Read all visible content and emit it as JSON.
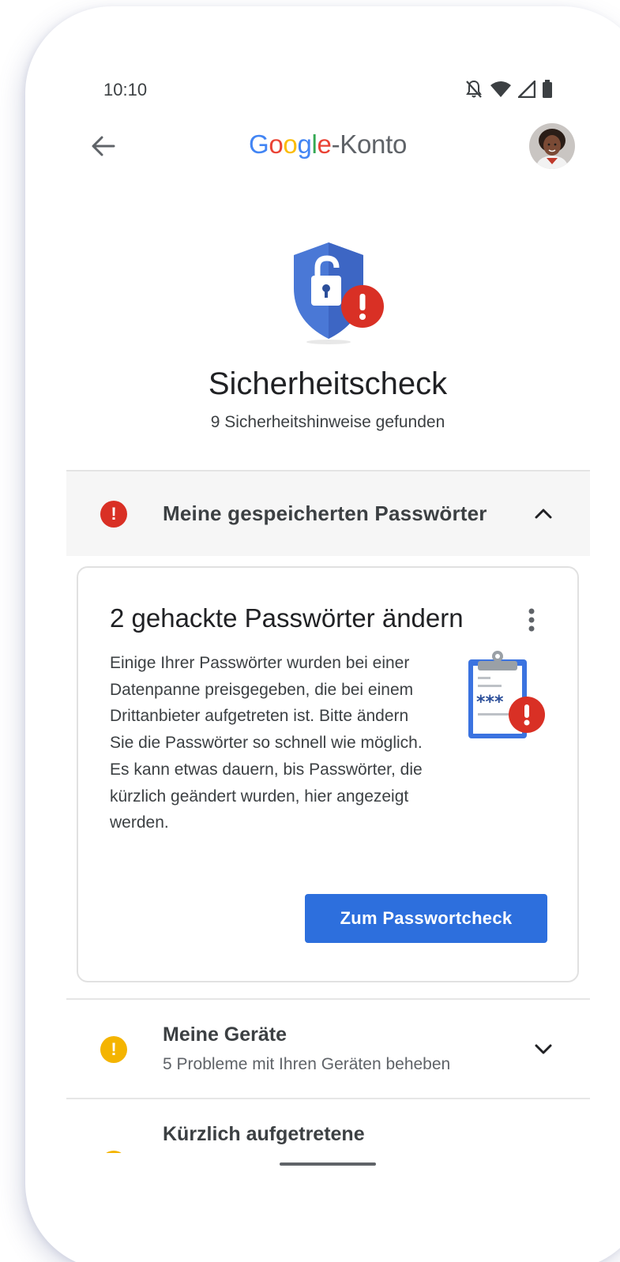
{
  "status_bar": {
    "time": "10:10",
    "icons": [
      "notifications-off-icon",
      "wifi-icon",
      "signal-icon",
      "battery-icon"
    ]
  },
  "header": {
    "brand": "Google",
    "title_suffix": "-Konto",
    "back_icon": "arrow-back-icon",
    "avatar_icon": "profile-avatar"
  },
  "hero": {
    "icon": "shield-lock-alert-icon",
    "title": "Sicherheitscheck",
    "subtitle": "9 Sicherheitshinweise gefunden"
  },
  "sections": [
    {
      "label": "Meine gespeicherten Passwörter",
      "status": "critical",
      "expanded": true,
      "card": {
        "title": "2 gehackte Passwörter ändern",
        "body": "Einige Ihrer Passwörter wurden bei einer Datenpanne preisgegeben, die bei einem Drittanbieter aufgetreten ist. Bitte ändern Sie die Passwörter so schnell wie möglich. Es kann etwas dauern, bis Passwörter, die kürzlich geändert wurden, hier angezeigt werden.",
        "illustration": "clipboard-password-alert-icon",
        "cta_label": "Zum Passwortcheck"
      }
    },
    {
      "label": "Meine Geräte",
      "subtitle": "5 Probleme mit Ihren Geräten beheben",
      "status": "warning",
      "expanded": false
    },
    {
      "label": "Kürzlich aufgetretene",
      "status": "warning",
      "expanded": false
    }
  ],
  "colors": {
    "google_blue": "#4285F4",
    "google_red": "#EA4335",
    "google_yellow": "#FBBC05",
    "google_green": "#34A853",
    "alert_red": "#D93025",
    "warning_yellow": "#F4B400",
    "primary_button": "#2D6FDD"
  }
}
